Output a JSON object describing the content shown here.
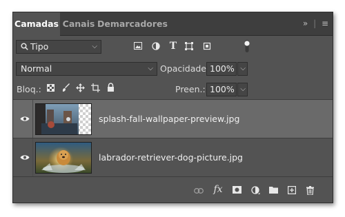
{
  "tabs": [
    {
      "label": "Camadas",
      "active": true
    },
    {
      "label": "Canais",
      "active": false
    },
    {
      "label": "Demarcadores",
      "active": false
    }
  ],
  "panel_menu": {
    "collapse_icon": "double-chevron-right-icon",
    "menu_icon": "hamburger-menu-icon"
  },
  "filter": {
    "label": "Tipo",
    "icon": "search-icon"
  },
  "filter_icons": [
    "image-filter-icon",
    "adjustment-filter-icon",
    "type-filter-icon",
    "shape-filter-icon",
    "smart-object-filter-icon",
    "filter-toggle-icon"
  ],
  "blend_mode": {
    "value": "Normal"
  },
  "opacity": {
    "label": "Opacidade:",
    "value": "100%"
  },
  "lock": {
    "label": "Bloq.:",
    "icons": [
      "lock-transparent-icon",
      "lock-image-icon",
      "lock-position-icon",
      "lock-artboard-icon",
      "lock-all-icon"
    ]
  },
  "fill": {
    "label": "Preen.:",
    "value": "100%"
  },
  "layers": [
    {
      "name": "splash-fall-wallpaper-preview.jpg",
      "selected": true,
      "visible": true
    },
    {
      "name": "labrador-retriever-dog-picture.jpg",
      "selected": false,
      "visible": true
    }
  ],
  "footer_icons": [
    "link-layers-icon",
    "fx-icon",
    "layer-mask-icon",
    "adjustment-layer-icon",
    "group-folder-icon",
    "new-layer-icon",
    "trash-icon"
  ],
  "colors": {
    "panel": "#535353",
    "tabbar": "#3e3e3e",
    "selected_row": "#6a6a6a"
  }
}
